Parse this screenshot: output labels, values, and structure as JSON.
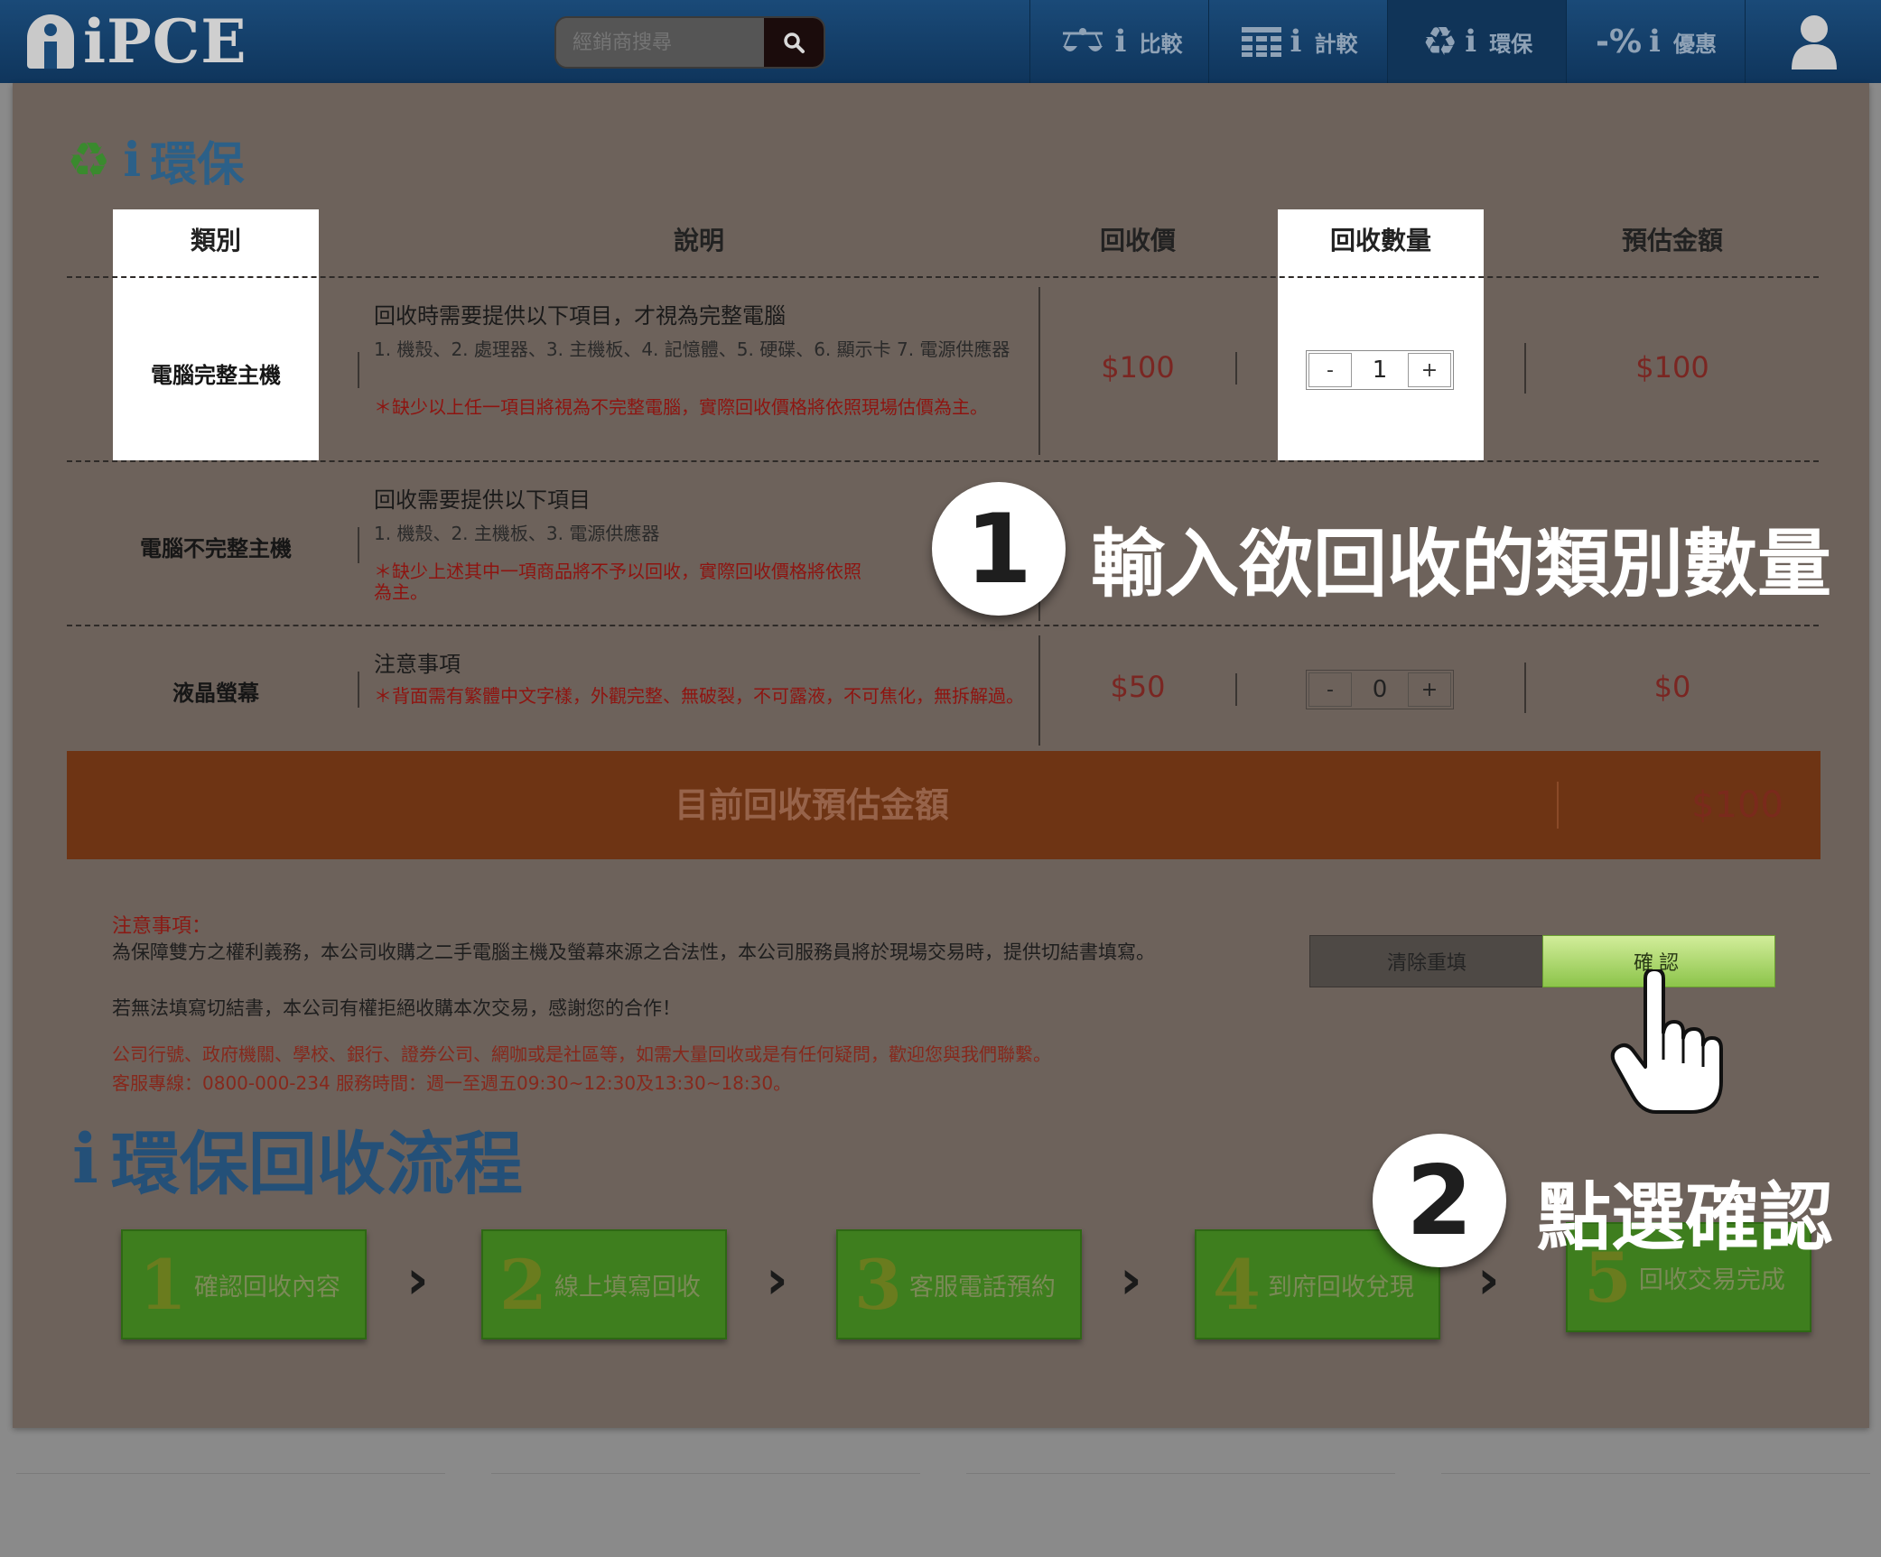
{
  "header": {
    "logo_text": "iPCE",
    "search_placeholder": "經銷商搜尋",
    "nav": [
      {
        "icon": "scale-icon",
        "prefix": "i",
        "label": "比較"
      },
      {
        "icon": "calculator-icon",
        "prefix": "i",
        "label": "計較"
      },
      {
        "icon": "recycle-icon",
        "prefix": "i",
        "label": "環保"
      },
      {
        "icon": "percent-icon",
        "prefix": "i",
        "label": "優惠"
      }
    ]
  },
  "page": {
    "heading_prefix": "i",
    "heading": "環保"
  },
  "table": {
    "headers": [
      "類別",
      "說明",
      "回收價",
      "回收數量",
      "預估金額"
    ],
    "rows": [
      {
        "category": "電腦完整主機",
        "desc_title": "回收時需要提供以下項目，才視為完整電腦",
        "desc_items": "1. 機殼、2. 處理器、3. 主機板、4. 記憶體、5. 硬碟、6. 顯示卡 7. 電源供應器",
        "desc_note": "＊缺少以上任一項目將視為不完整電腦，實際回收價格將依照現場估價為主。",
        "price": "$100",
        "qty": "1",
        "estimate": "$100"
      },
      {
        "category": "電腦不完整主機",
        "desc_title": "回收需要提供以下項目",
        "desc_items": "1. 機殼、2. 主機板、3. 電源供應器",
        "desc_note": "＊缺少上述其中一項商品將不予以回收，實際回收價格將依照",
        "desc_note2": "為主。"
      },
      {
        "category": "液晶螢幕",
        "desc_title": "注意事項",
        "desc_note": "＊背面需有繁體中文字樣，外觀完整、無破裂，不可露液，不可焦化，無拆解過。",
        "price": "$50",
        "qty": "0",
        "estimate": "$0"
      }
    ],
    "minus": "-",
    "plus": "+"
  },
  "total": {
    "label": "目前回收預估金額",
    "value": "$100"
  },
  "notice": {
    "title": "注意事項：",
    "line1": "為保障雙方之權利義務，本公司收購之二手電腦主機及螢幕來源之合法性，本公司服務員將於現場交易時，提供切結書填寫。",
    "line2": "若無法填寫切結書，本公司有權拒絕收購本次交易，感謝您的合作！",
    "red1": "公司行號、政府機關、學校、銀行、證券公司、網咖或是社區等，如需大量回收或是有任何疑問，歡迎您與我們聯繫。",
    "red2": "客服專線：0800-000-234 服務時間：週一至週五09:30~12:30及13:30~18:30。"
  },
  "buttons": {
    "reset": "清除重填",
    "confirm": "確認"
  },
  "flow": {
    "title_prefix": "i",
    "title": "環保回收流程",
    "steps": [
      {
        "num": "1",
        "label": "確認回收內容"
      },
      {
        "num": "2",
        "label": "線上填寫回收"
      },
      {
        "num": "3",
        "label": "客服電話預約"
      },
      {
        "num": "4",
        "label": "到府回收兌現"
      },
      {
        "num": "5",
        "label": "回收交易完成"
      }
    ],
    "arrow": "›"
  },
  "callouts": [
    {
      "num": "1",
      "text": "輸入欲回收的類別數量"
    },
    {
      "num": "2",
      "text": "點選確認"
    }
  ],
  "colors": {
    "nav_bg": "#0f355c",
    "overlay": "#6d625b",
    "total_bar": "#6e3414",
    "confirm_green": "#8cc44a",
    "step_green": "#3e7e1e"
  }
}
